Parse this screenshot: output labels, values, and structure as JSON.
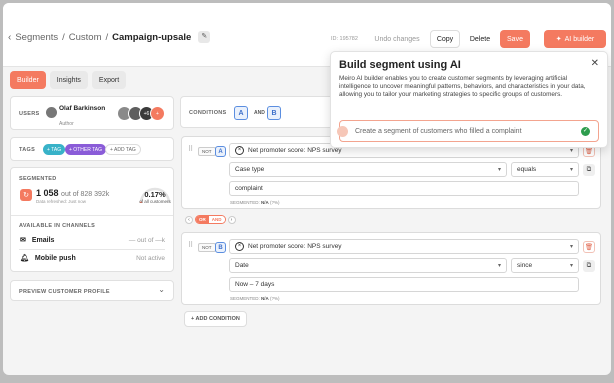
{
  "breadcrumb": {
    "items": [
      "Segments",
      "Custom"
    ],
    "current": "Campaign-upsale"
  },
  "segment_id": "ID: 195782",
  "toolbar": {
    "undo": "Undo changes",
    "copy": "Copy",
    "delete": "Delete",
    "save": "Save",
    "ai_builder": "AI builder"
  },
  "tabs": [
    "Builder",
    "Insights",
    "Export"
  ],
  "users": {
    "label": "USERS",
    "name": "Olaf Barkinson",
    "role": "Author",
    "extra": "+6"
  },
  "tags": {
    "label": "TAGS",
    "items": [
      "+ TAG",
      "+ OTHER TAG",
      "+ ADD TAG"
    ]
  },
  "segmented": {
    "label": "SEGMENTED",
    "count": "1 058",
    "total": "out of 828 392k",
    "refreshed": "Data refreshed: Just now",
    "percent": "0.17%",
    "percent_caption": "of all customers",
    "percent_value": 0.17
  },
  "channels": {
    "label": "AVAILABLE IN CHANNELS",
    "items": [
      {
        "name": "Emails",
        "value": "— out of —k"
      },
      {
        "name": "Mobile push",
        "value": "Not active"
      }
    ]
  },
  "preview": {
    "label": "PREVIEW CUSTOMER PROFILE"
  },
  "conditions": {
    "label": "CONDITIONS",
    "letters": [
      "A",
      "B"
    ],
    "and": "AND",
    "items": [
      {
        "not": "NOT",
        "letter": "A",
        "attribute": "Net promoter score: NPS survey",
        "field": "Case type",
        "operator": "equals",
        "value": "complaint",
        "segmented_label": "SEGMENTED:",
        "segmented_value": "N/A",
        "segmented_pct": "(?%)"
      },
      {
        "not": "NOT",
        "letter": "B",
        "attribute": "Net promoter score: NPS survey",
        "field": "Date",
        "operator": "since",
        "value": "Now – 7 days",
        "segmented_label": "SEGMENTED:",
        "segmented_value": "N/A",
        "segmented_pct": "(?%)"
      }
    ],
    "or_label": "OR",
    "and_label": "AND",
    "add": "+ ADD CONDITION"
  },
  "ai_popup": {
    "title": "Build segment using AI",
    "description": "Meiro AI builder enables you to create customer segments by leveraging artificial intelligence to uncover meaningful patterns, behaviors, and characteristics in your data, allowing you to tailor your marketing strategies to specific groups of customers.",
    "placeholder": "Create a segment of customers who filled a complaint"
  },
  "colors": {
    "accent": "#f47a60",
    "condition_letter": "#5b8ee0",
    "tag_teal": "#38b2c8",
    "tag_purple": "#8a5cd8",
    "success": "#2e9d4e"
  }
}
